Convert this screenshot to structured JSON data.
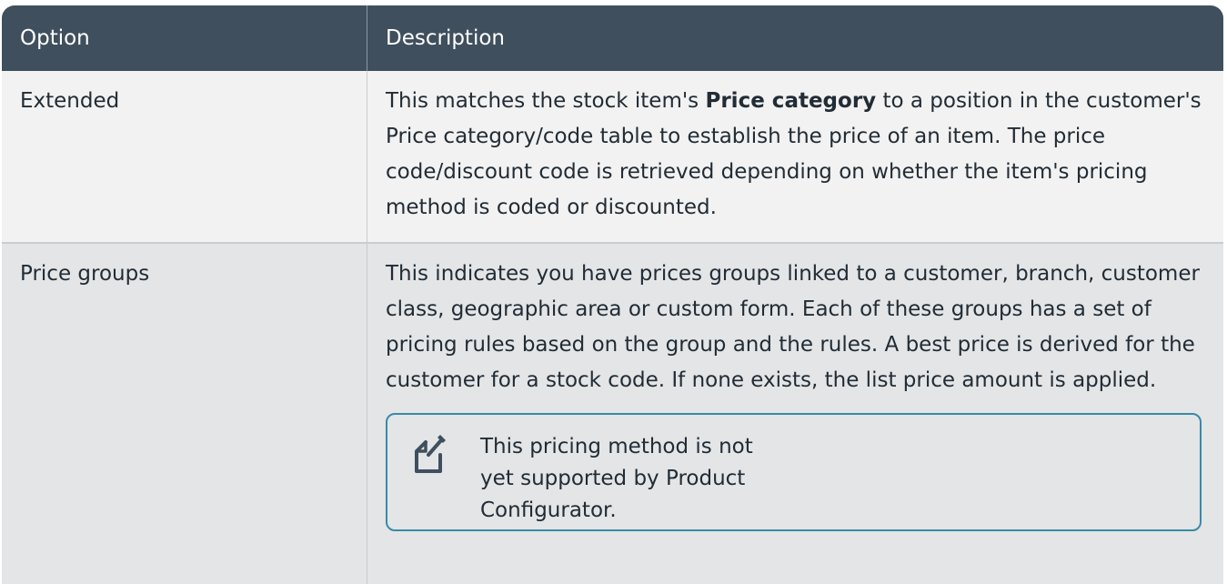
{
  "table": {
    "headers": {
      "option": "Option",
      "description": "Description"
    },
    "rows": [
      {
        "option": "Extended",
        "description_before": "This matches the stock item's ",
        "description_bold": "Price category",
        "description_after": " to a position in the customer's Price category/code table to establish the price of an item. The price code/discount code is retrieved depending on whether the item's pricing method is coded or discounted."
      },
      {
        "option": "Price groups",
        "description": "This indicates you have prices groups linked to a customer, branch, customer class, geographic area or custom form. Each of these groups has a set of pricing rules based on the group and the rules. A best price is derived for the customer for a stock code. If none exists, the list price amount is applied.",
        "note": {
          "icon": "note-pencil-icon",
          "text": "This pricing method is not yet supported by Product Configurator."
        }
      }
    ]
  },
  "colors": {
    "header_bg": "#3f4f5d",
    "row1_bg": "#f2f2f2",
    "row2_bg": "#e3e5e7",
    "note_border": "#3a8aa8",
    "text": "#222c35"
  }
}
